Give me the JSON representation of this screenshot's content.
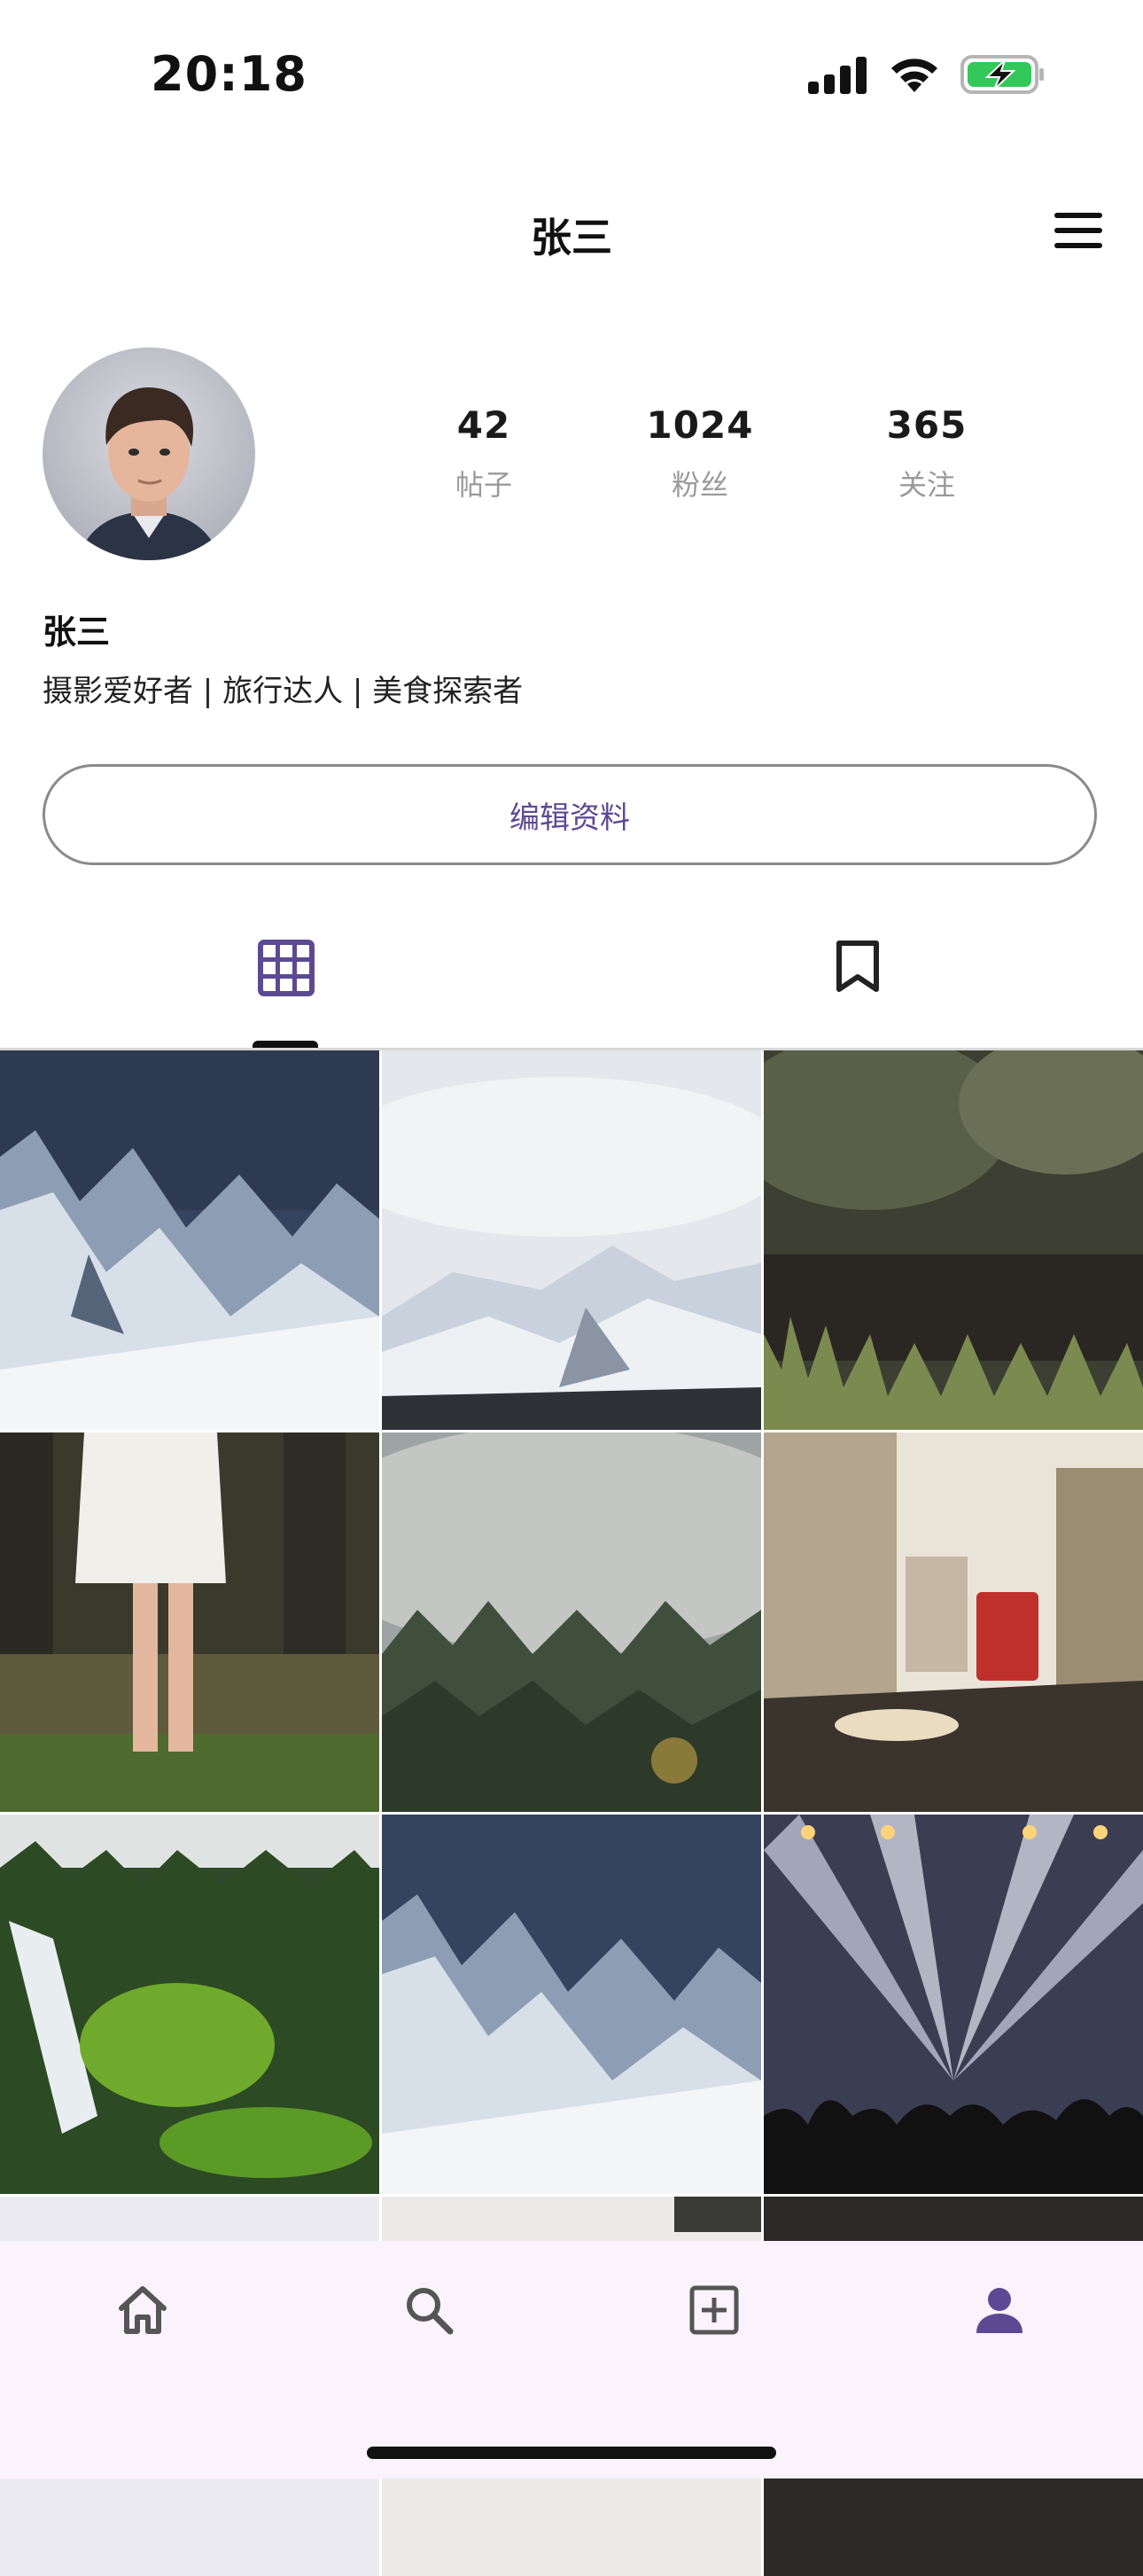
{
  "status_bar": {
    "time": "20:18",
    "icons": [
      "signal-icon",
      "wifi-icon",
      "battery-charging-icon"
    ]
  },
  "header": {
    "title": "张三",
    "menu_icon": "hamburger-menu-icon"
  },
  "profile": {
    "name": "张三",
    "bio": "摄影爱好者 | 旅行达人 | 美食探索者",
    "stats": [
      {
        "value": "42",
        "label": "帖子"
      },
      {
        "value": "1024",
        "label": "粉丝"
      },
      {
        "value": "365",
        "label": "关注"
      }
    ],
    "edit_button": "编辑资料"
  },
  "tabs": [
    {
      "icon": "grid-icon",
      "active": true
    },
    {
      "icon": "bookmark-icon",
      "active": false
    }
  ],
  "grid_photos": [
    "snowy-mountains",
    "snowy-mountain-clouds",
    "grass-bokeh",
    "person-standing-forest",
    "misty-forest",
    "city-street-bus",
    "waterfall-green",
    "snowy-mountains",
    "concert-lights",
    "partial-photo",
    "partial-photo",
    "partial-photo"
  ],
  "bottom_nav": [
    {
      "icon": "home-icon",
      "active": false
    },
    {
      "icon": "search-icon",
      "active": false
    },
    {
      "icon": "add-post-icon",
      "active": false
    },
    {
      "icon": "profile-icon",
      "active": true
    }
  ],
  "colors": {
    "accent": "#5b4a93",
    "nav_bg": "#fbf3fc"
  }
}
